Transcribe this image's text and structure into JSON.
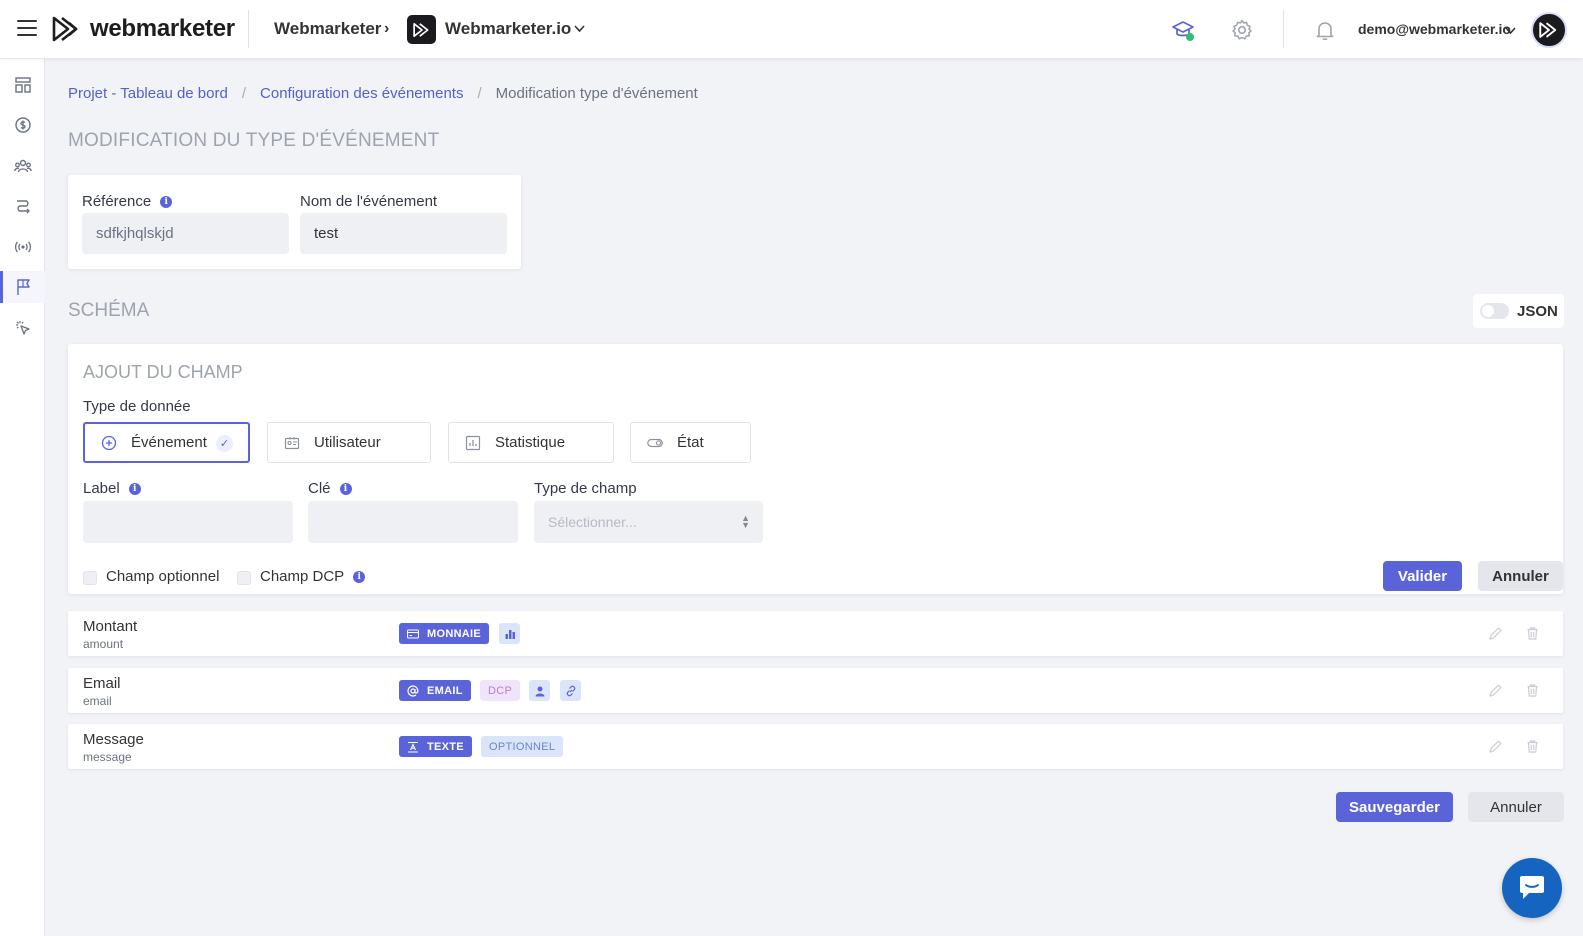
{
  "brand": {
    "logo_text": "webmarketer"
  },
  "header": {
    "organization": "Webmarketer",
    "project": "Webmarketer.io",
    "user_email": "demo@webmarketer.io"
  },
  "breadcrumb": {
    "items": [
      "Projet - Tableau de bord",
      "Configuration des événements"
    ],
    "current": "Modification type d'événement"
  },
  "page_title": "MODIFICATION DU TYPE D'ÉVÉNEMENT",
  "event": {
    "reference_label": "Référence",
    "reference_value": "sdfkjhqlskjd",
    "name_label": "Nom de l'événement",
    "name_value": "test"
  },
  "schema": {
    "title": "SCHÉMA",
    "json_toggle_label": "JSON",
    "json_enabled": false
  },
  "add_field": {
    "title": "AJOUT DU CHAMP",
    "data_type_label": "Type de donnée",
    "data_types": [
      "Événement",
      "Utilisateur",
      "Statistique",
      "État"
    ],
    "selected_data_type": "Événement",
    "label_label": "Label",
    "label_value": "",
    "key_label": "Clé",
    "key_value": "",
    "field_type_label": "Type de champ",
    "field_type_placeholder": "Sélectionner...",
    "optional_label": "Champ optionnel",
    "dcp_label": "Champ DCP",
    "validate_label": "Valider",
    "cancel_label": "Annuler"
  },
  "fields": [
    {
      "title": "Montant",
      "key": "amount",
      "type_tag": "MONNAIE",
      "extra_tags": []
    },
    {
      "title": "Email",
      "key": "email",
      "type_tag": "EMAIL",
      "extra_tags": [
        "DCP"
      ]
    },
    {
      "title": "Message",
      "key": "message",
      "type_tag": "TEXTE",
      "extra_tags": [
        "OPTIONNEL"
      ]
    }
  ],
  "footer": {
    "save_label": "Sauvegarder",
    "cancel_label": "Annuler"
  },
  "colors": {
    "accent": "#5a64d8",
    "background": "#f2f3f7",
    "chat": "#1565c0"
  }
}
